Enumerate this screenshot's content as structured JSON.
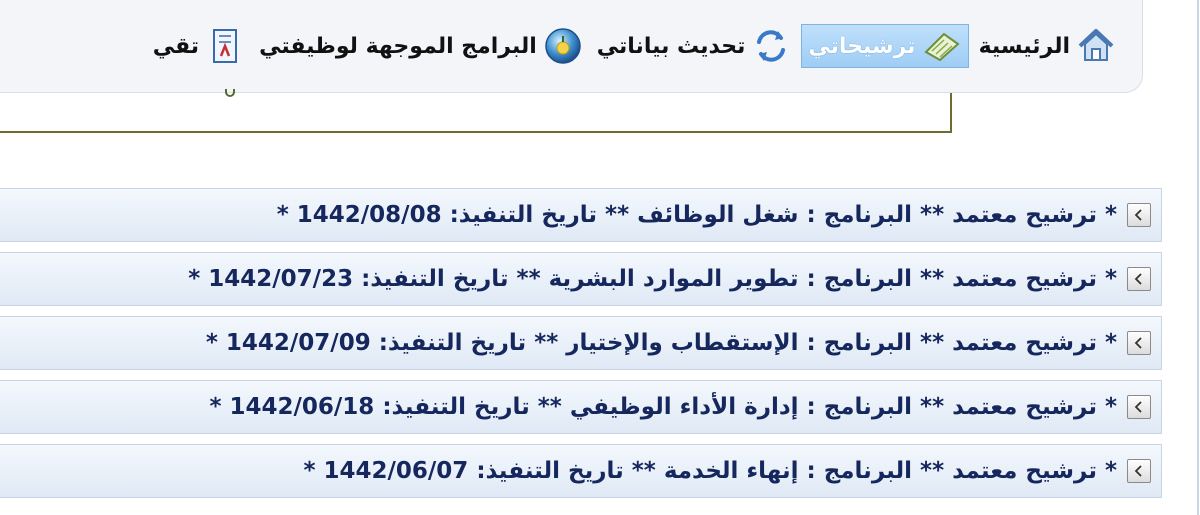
{
  "nav": {
    "items": [
      {
        "label": "الرئيسية",
        "icon": "home-icon",
        "active": false
      },
      {
        "label": "ترشيحاتي",
        "icon": "document-icon",
        "active": true
      },
      {
        "label": "تحديث بياناتي",
        "icon": "refresh-icon",
        "active": false
      },
      {
        "label": "البرامج الموجهة لوظيفتي",
        "icon": "globe-icon",
        "active": false
      },
      {
        "label": "تقي",
        "icon": "report-icon",
        "active": false
      }
    ]
  },
  "colors": {
    "active_tab": "#a8d3f7",
    "row_text": "#15275c",
    "row_bg": "#e6eef8"
  },
  "rows": [
    {
      "text": "* ترشيح معتمد ** البرنامج : شغل الوظائف ** تاريخ التنفيذ: ",
      "date": "1442/08/08",
      "tail": " *"
    },
    {
      "text": "* ترشيح معتمد ** البرنامج : تطوير الموارد البشرية ** تاريخ التنفيذ: ",
      "date": "1442/07/23",
      "tail": " *"
    },
    {
      "text": "* ترشيح معتمد ** البرنامج : الإستقطاب والإختيار ** تاريخ التنفيذ: ",
      "date": "1442/07/09",
      "tail": " *"
    },
    {
      "text": "* ترشيح معتمد ** البرنامج : إدارة الأداء الوظيفي ** تاريخ التنفيذ: ",
      "date": "1442/06/18",
      "tail": " *"
    },
    {
      "text": "* ترشيح معتمد ** البرنامج : إنهاء الخدمة ** تاريخ التنفيذ: ",
      "date": "1442/06/07",
      "tail": " *"
    }
  ]
}
